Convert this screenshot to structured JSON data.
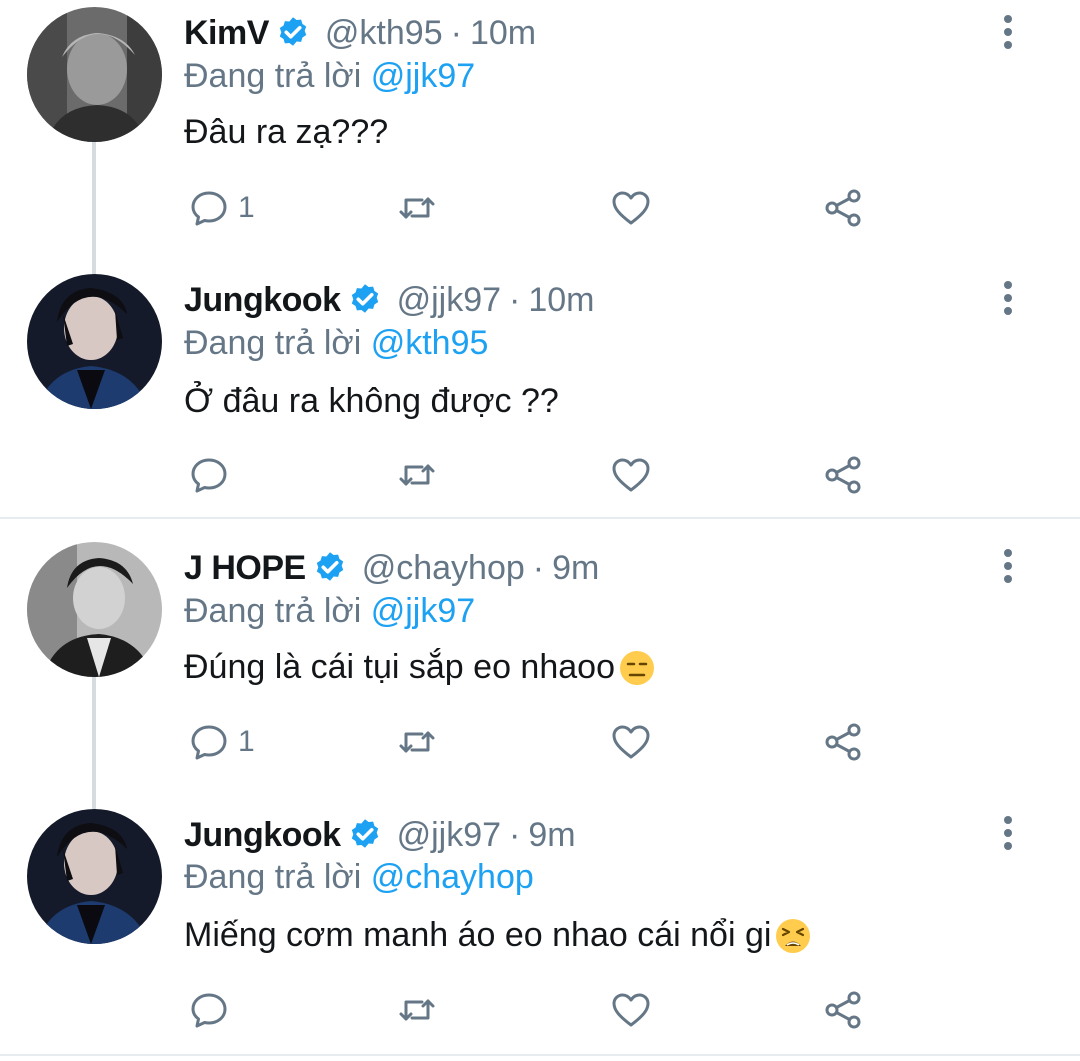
{
  "colors": {
    "accent": "#1da1f2",
    "muted": "#657786",
    "text": "#14171a",
    "divider": "#e6ecf0"
  },
  "icons": {
    "more": "more-vertical-icon",
    "reply": "reply-icon",
    "retweet": "retweet-icon",
    "like": "heart-icon",
    "share": "share-icon",
    "verified": "verified-badge-icon"
  },
  "tweets": [
    {
      "name": "KimV",
      "handle": "@kth95",
      "sep": "·",
      "time": "10m",
      "replying_label": "Đang trả lời",
      "replying_to": "@jjk97",
      "text": "Đâu ra zạ???",
      "reply_count": "1"
    },
    {
      "name": "Jungkook",
      "handle": "@jjk97",
      "sep": "·",
      "time": "10m",
      "replying_label": "Đang trả lời",
      "replying_to": "@kth95",
      "text": "Ở đâu ra không được ??",
      "reply_count": ""
    },
    {
      "name": "J HOPE",
      "handle": "@chayhop",
      "sep": "·",
      "time": "9m",
      "replying_label": "Đang trả lời",
      "replying_to": "@jjk97",
      "text": "Đúng là cái tụi sắp eo nhaoo",
      "emoji": "expressionless-face-emoji",
      "reply_count": "1"
    },
    {
      "name": "Jungkook",
      "handle": "@jjk97",
      "sep": "·",
      "time": "9m",
      "replying_label": "Đang trả lời",
      "replying_to": "@chayhop",
      "text": "Miếng cơm manh áo eo nhao cái nổi gi ",
      "emoji": "tired-face-emoji",
      "reply_count": ""
    }
  ]
}
